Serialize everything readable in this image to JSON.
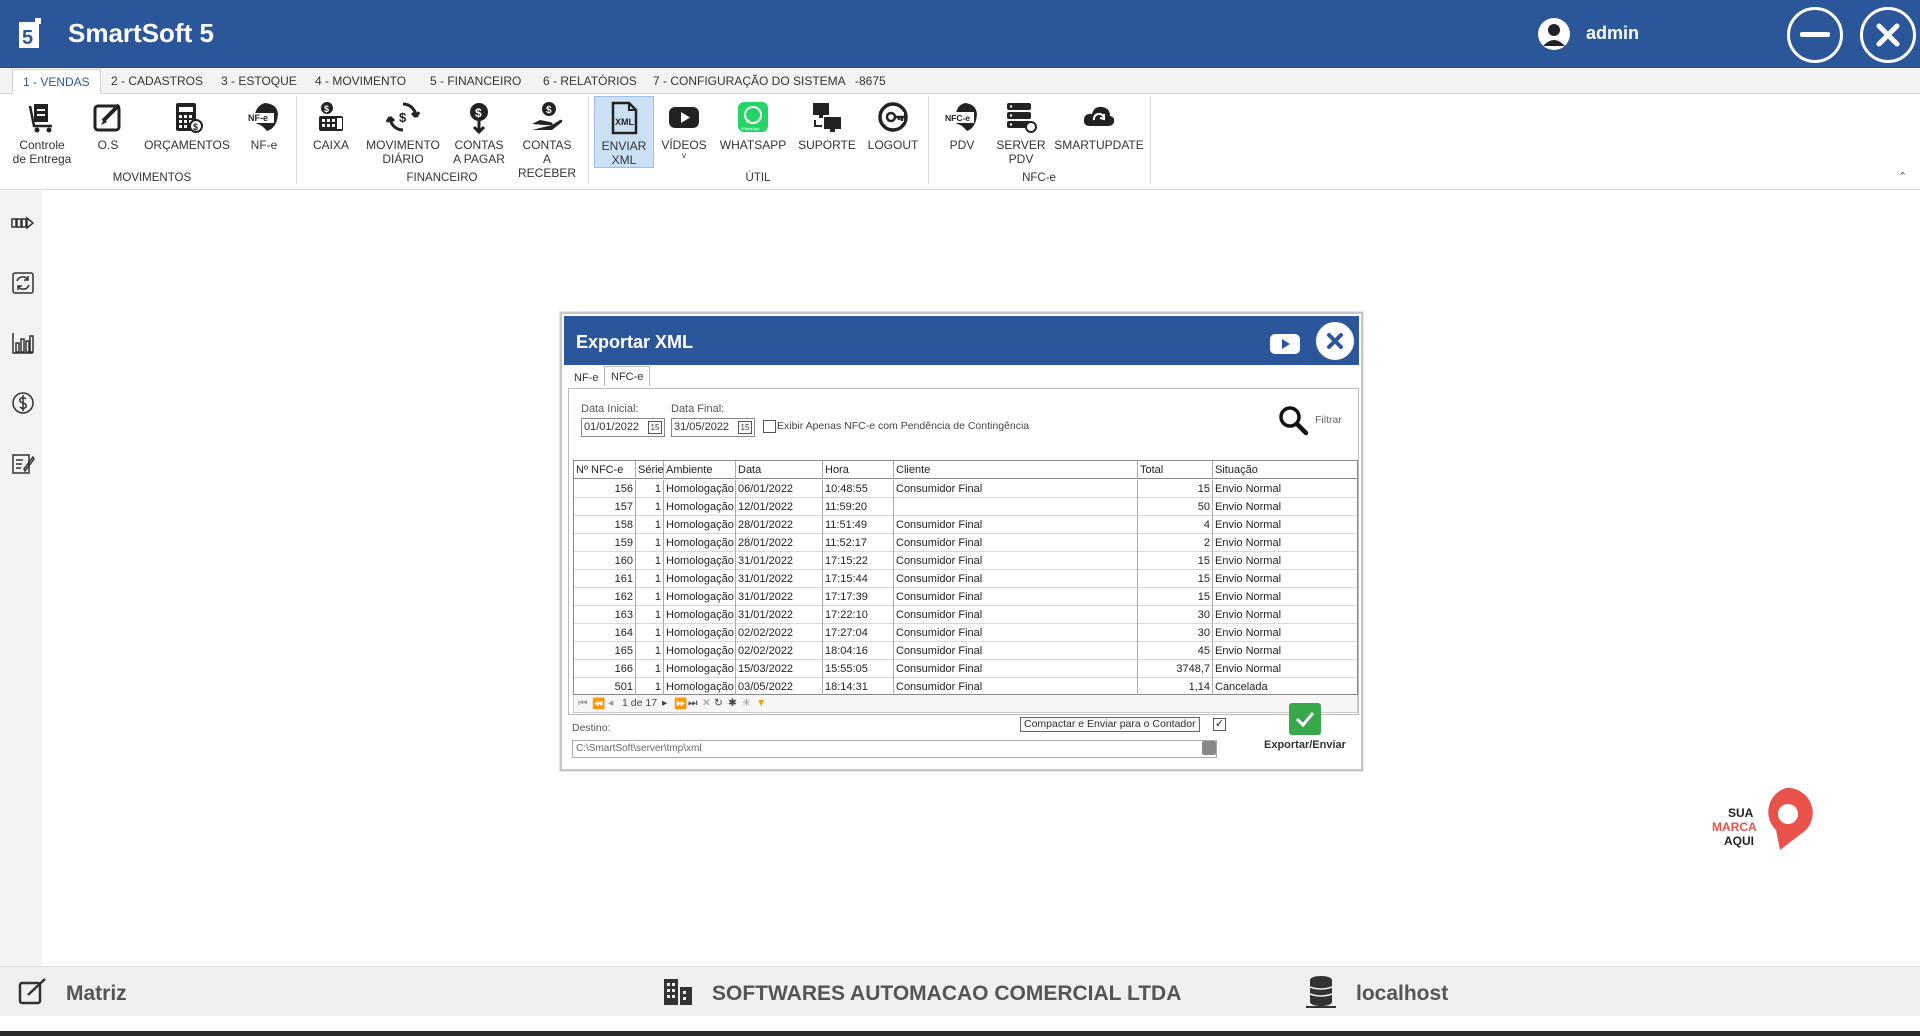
{
  "app": {
    "title": "SmartSoft 5",
    "user": "admin"
  },
  "menu_tabs": [
    "1 - VENDAS",
    "2 - CADASTROS",
    "3 - ESTOQUE",
    "4 - MOVIMENTO",
    "5 - FINANCEIRO",
    "6 - RELATÓRIOS",
    "7 - CONFIGURAÇÃO DO SISTEMA",
    "-8675"
  ],
  "ribbon": {
    "buttons": [
      {
        "l1": "Controle",
        "l2": "de Entrega"
      },
      {
        "l1": "O.S",
        "l2": ""
      },
      {
        "l1": "ORÇAMENTOS",
        "l2": ""
      },
      {
        "l1": "NF-e",
        "l2": ""
      },
      {
        "l1": "CAIXA",
        "l2": ""
      },
      {
        "l1": "MOVIMENTO",
        "l2": "DIÁRIO"
      },
      {
        "l1": "CONTAS",
        "l2": "A PAGAR"
      },
      {
        "l1": "CONTAS",
        "l2": "A RECEBER"
      },
      {
        "l1": "ENVIAR",
        "l2": "XML"
      },
      {
        "l1": "VÍDEOS",
        "l2": "˅"
      },
      {
        "l1": "WHATSAPP",
        "l2": ""
      },
      {
        "l1": "SUPORTE",
        "l2": ""
      },
      {
        "l1": "LOGOUT",
        "l2": ""
      },
      {
        "l1": "PDV",
        "l2": ""
      },
      {
        "l1": "SERVER",
        "l2": "PDV"
      },
      {
        "l1": "SMARTUPDATE",
        "l2": ""
      }
    ],
    "groups": [
      "MOVIMENTOS",
      "FINANCEIRO",
      "ÚTIL",
      "NFC-e"
    ],
    "icon_texts": {
      "nfe": "NF-e",
      "xml": "XML",
      "nfce": "NFC-e"
    }
  },
  "dialog": {
    "title": "Exportar XML",
    "tabs": [
      "NF-e",
      "NFC-e"
    ],
    "data_inicial_label": "Data Inicial:",
    "data_inicial": "01/01/2022",
    "data_final_label": "Data Final:",
    "data_final": "31/05/2022",
    "calendar_glyph": "15",
    "contingencia_label": "Exibir Apenas NFC-e com Pendência de Contingência",
    "filtrar": "Filtrar",
    "columns": [
      "Nº NFC-e",
      "Série",
      "Ambiente",
      "Data",
      "Hora",
      "Cliente",
      "Total",
      "Situação"
    ],
    "rows": [
      [
        "156",
        "1",
        "Homologação",
        "06/01/2022",
        "10:48:55",
        "Consumidor Final",
        "15",
        "Envio Normal"
      ],
      [
        "157",
        "1",
        "Homologação",
        "12/01/2022",
        "11:59:20",
        "",
        "50",
        "Envio Normal"
      ],
      [
        "158",
        "1",
        "Homologação",
        "28/01/2022",
        "11:51:49",
        "Consumidor Final",
        "4",
        "Envio Normal"
      ],
      [
        "159",
        "1",
        "Homologação",
        "28/01/2022",
        "11:52:17",
        "Consumidor Final",
        "2",
        "Envio Normal"
      ],
      [
        "160",
        "1",
        "Homologação",
        "31/01/2022",
        "17:15:22",
        "Consumidor Final",
        "15",
        "Envio Normal"
      ],
      [
        "161",
        "1",
        "Homologação",
        "31/01/2022",
        "17:15:44",
        "Consumidor Final",
        "15",
        "Envio Normal"
      ],
      [
        "162",
        "1",
        "Homologação",
        "31/01/2022",
        "17:17:39",
        "Consumidor Final",
        "15",
        "Envio Normal"
      ],
      [
        "163",
        "1",
        "Homologação",
        "31/01/2022",
        "17:22:10",
        "Consumidor Final",
        "30",
        "Envio Normal"
      ],
      [
        "164",
        "1",
        "Homologação",
        "02/02/2022",
        "17:27:04",
        "Consumidor Final",
        "30",
        "Envio Normal"
      ],
      [
        "165",
        "1",
        "Homologação",
        "02/02/2022",
        "18:04:16",
        "Consumidor Final",
        "45",
        "Envio Normal"
      ],
      [
        "166",
        "1",
        "Homologação",
        "15/03/2022",
        "15:55:05",
        "Consumidor Final",
        "3748,7",
        "Envio Normal"
      ],
      [
        "501",
        "1",
        "Homologação",
        "03/05/2022",
        "18:14:31",
        "Consumidor Final",
        "1,14",
        "Cancelada"
      ]
    ],
    "pager": "1 de 17",
    "destino_label": "Destino:",
    "destino": "C:\\SmartSoft\\server\\tmp\\xml",
    "compactar_label": "Compactar e Enviar para o Contador",
    "compactar_checked": true,
    "export_label": "Exportar/Enviar"
  },
  "status": {
    "filial": "Matriz",
    "empresa": "SOFTWARES AUTOMACAO COMERCIAL LTDA",
    "servidor": "localhost"
  },
  "brand": {
    "l1": "SUA",
    "l2": "MARCA",
    "l3": "AQUI"
  },
  "colors": {
    "primary": "#2b579a",
    "accent": "#e8524a",
    "ok": "#38a84a",
    "whatsapp": "#25d366"
  }
}
